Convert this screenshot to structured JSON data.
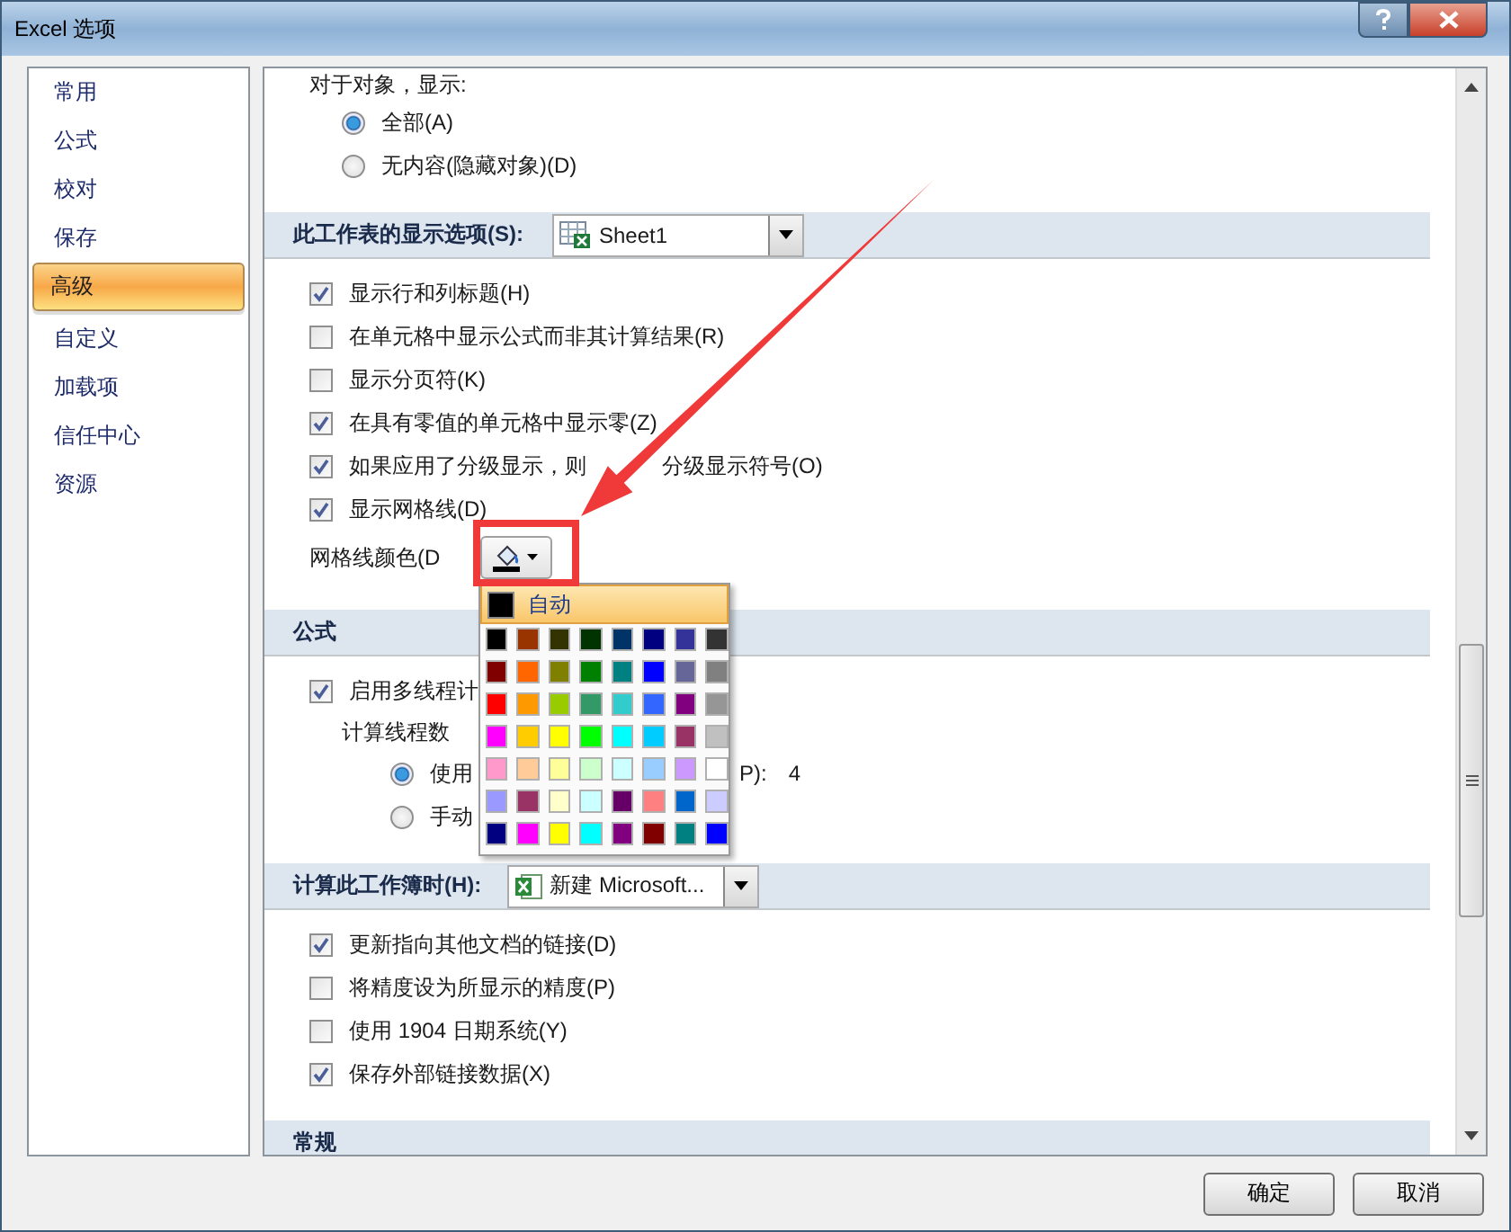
{
  "window": {
    "title": "Excel 选项"
  },
  "sidebar": {
    "items": [
      {
        "label": "常用",
        "selected": false
      },
      {
        "label": "公式",
        "selected": false
      },
      {
        "label": "校对",
        "selected": false
      },
      {
        "label": "保存",
        "selected": false
      },
      {
        "label": "高级",
        "selected": true
      },
      {
        "label": "自定义",
        "selected": false
      },
      {
        "label": "加载项",
        "selected": false
      },
      {
        "label": "信任中心",
        "selected": false
      },
      {
        "label": "资源",
        "selected": false
      }
    ]
  },
  "sections": [
    {
      "items": [
        {
          "kind": "group",
          "label": "对于对象，显示:",
          "options": [
            {
              "label": "全部(A)",
              "selected": true
            },
            {
              "label": "无内容(隐藏对象)(D)",
              "selected": false
            }
          ]
        }
      ]
    },
    {
      "title": "此工作表的显示选项(S):",
      "combo": {
        "kind": "sheet",
        "value": "Sheet1"
      },
      "items": [
        {
          "kind": "checkbox",
          "label": "显示行和列标题(H)",
          "checked": true
        },
        {
          "kind": "checkbox",
          "label": "在单元格中显示公式而非其计算结果(R)",
          "checked": false
        },
        {
          "kind": "checkbox",
          "label": "显示分页符(K)",
          "checked": false
        },
        {
          "kind": "checkbox",
          "label": "在具有零值的单元格中显示零(Z)",
          "checked": true
        },
        {
          "kind": "checkbox",
          "label": "如果应用了分级显示，则",
          "label_after": "分级显示符号(O)",
          "checked": true
        },
        {
          "kind": "checkbox",
          "label": "显示网格线(D)",
          "checked": true
        },
        {
          "kind": "color",
          "label": "网格线颜色(D",
          "menu": {
            "auto": {
              "label": "自动",
              "selected": true,
              "color": "#000000"
            },
            "swatches": [
              {
                "color": "#000000"
              },
              {
                "color": "#993300"
              },
              {
                "color": "#333300"
              },
              {
                "color": "#003300"
              },
              {
                "color": "#003366"
              },
              {
                "color": "#000080"
              },
              {
                "color": "#333399"
              },
              {
                "color": "#333333"
              },
              {
                "color": "#800000"
              },
              {
                "color": "#ff6600"
              },
              {
                "color": "#808000"
              },
              {
                "color": "#008000"
              },
              {
                "color": "#008080"
              },
              {
                "color": "#0000ff"
              },
              {
                "color": "#666699"
              },
              {
                "color": "#808080"
              },
              {
                "color": "#ff0000"
              },
              {
                "color": "#ff9900"
              },
              {
                "color": "#99cc00"
              },
              {
                "color": "#339966"
              },
              {
                "color": "#33cccc"
              },
              {
                "color": "#3366ff"
              },
              {
                "color": "#800080"
              },
              {
                "color": "#969696"
              },
              {
                "color": "#ff00ff"
              },
              {
                "color": "#ffcc00"
              },
              {
                "color": "#ffff00"
              },
              {
                "color": "#00ff00"
              },
              {
                "color": "#00ffff"
              },
              {
                "color": "#00ccff"
              },
              {
                "color": "#993366"
              },
              {
                "color": "#c0c0c0"
              },
              {
                "color": "#ff99cc"
              },
              {
                "color": "#ffcc99"
              },
              {
                "color": "#ffff99"
              },
              {
                "color": "#ccffcc"
              },
              {
                "color": "#ccffff"
              },
              {
                "color": "#99ccff"
              },
              {
                "color": "#cc99ff"
              },
              {
                "color": "#ffffff"
              },
              {
                "color": "#9999ff"
              },
              {
                "color": "#993366"
              },
              {
                "color": "#ffffcc"
              },
              {
                "color": "#ccffff"
              },
              {
                "color": "#660066"
              },
              {
                "color": "#ff8080"
              },
              {
                "color": "#0066cc"
              },
              {
                "color": "#ccccff"
              },
              {
                "color": "#000080"
              },
              {
                "color": "#ff00ff"
              },
              {
                "color": "#ffff00"
              },
              {
                "color": "#00ffff"
              },
              {
                "color": "#800080"
              },
              {
                "color": "#800000"
              },
              {
                "color": "#008080"
              },
              {
                "color": "#0000ff"
              }
            ]
          }
        }
      ]
    },
    {
      "title": "公式",
      "items": [
        {
          "kind": "checkbox",
          "label": "启用多线程计",
          "checked": true,
          "children": [
            {
              "kind": "group",
              "label": "计算线程数",
              "options": [
                {
                  "label": "使用",
                  "selected": true,
                  "suffix": "P):",
                  "value": "4"
                },
                {
                  "label": "手动",
                  "selected": false
                }
              ]
            }
          ]
        }
      ]
    },
    {
      "title": "计算此工作簿时(H):",
      "combo": {
        "kind": "workbook",
        "value": "新建 Microsoft..."
      },
      "items": [
        {
          "kind": "checkbox",
          "label": "更新指向其他文档的链接(D)",
          "checked": true
        },
        {
          "kind": "checkbox",
          "label": "将精度设为所显示的精度(P)",
          "checked": false
        },
        {
          "kind": "checkbox",
          "label": "使用 1904 日期系统(Y)",
          "checked": false
        },
        {
          "kind": "checkbox",
          "label": "保存外部链接数据(X)",
          "checked": true
        }
      ]
    },
    {
      "title": "常规"
    }
  ],
  "buttons": [
    {
      "label": "确定"
    },
    {
      "label": "取消"
    }
  ]
}
